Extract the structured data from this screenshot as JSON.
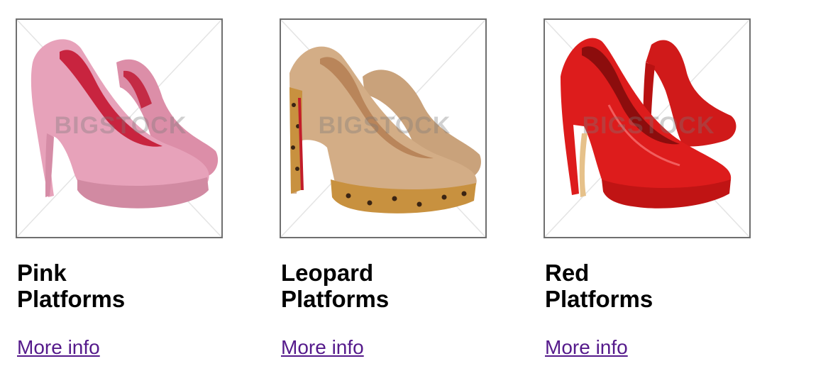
{
  "watermark_text": "BIGSTOCK",
  "products": [
    {
      "title": "Pink Platforms",
      "link_label": "More info",
      "image_icon": "pink-glitter-platform-heels",
      "color": "#e99ab4"
    },
    {
      "title": "Leopard Platforms",
      "link_label": "More info",
      "image_icon": "leopard-platform-heels",
      "color": "#c9a27b"
    },
    {
      "title": "Red Platforms",
      "link_label": "More info",
      "image_icon": "red-patent-platform-heels",
      "color": "#d41414"
    }
  ],
  "colors": {
    "link": "#551a8b",
    "frame_border": "#6f6f6f",
    "title": "#000000"
  }
}
